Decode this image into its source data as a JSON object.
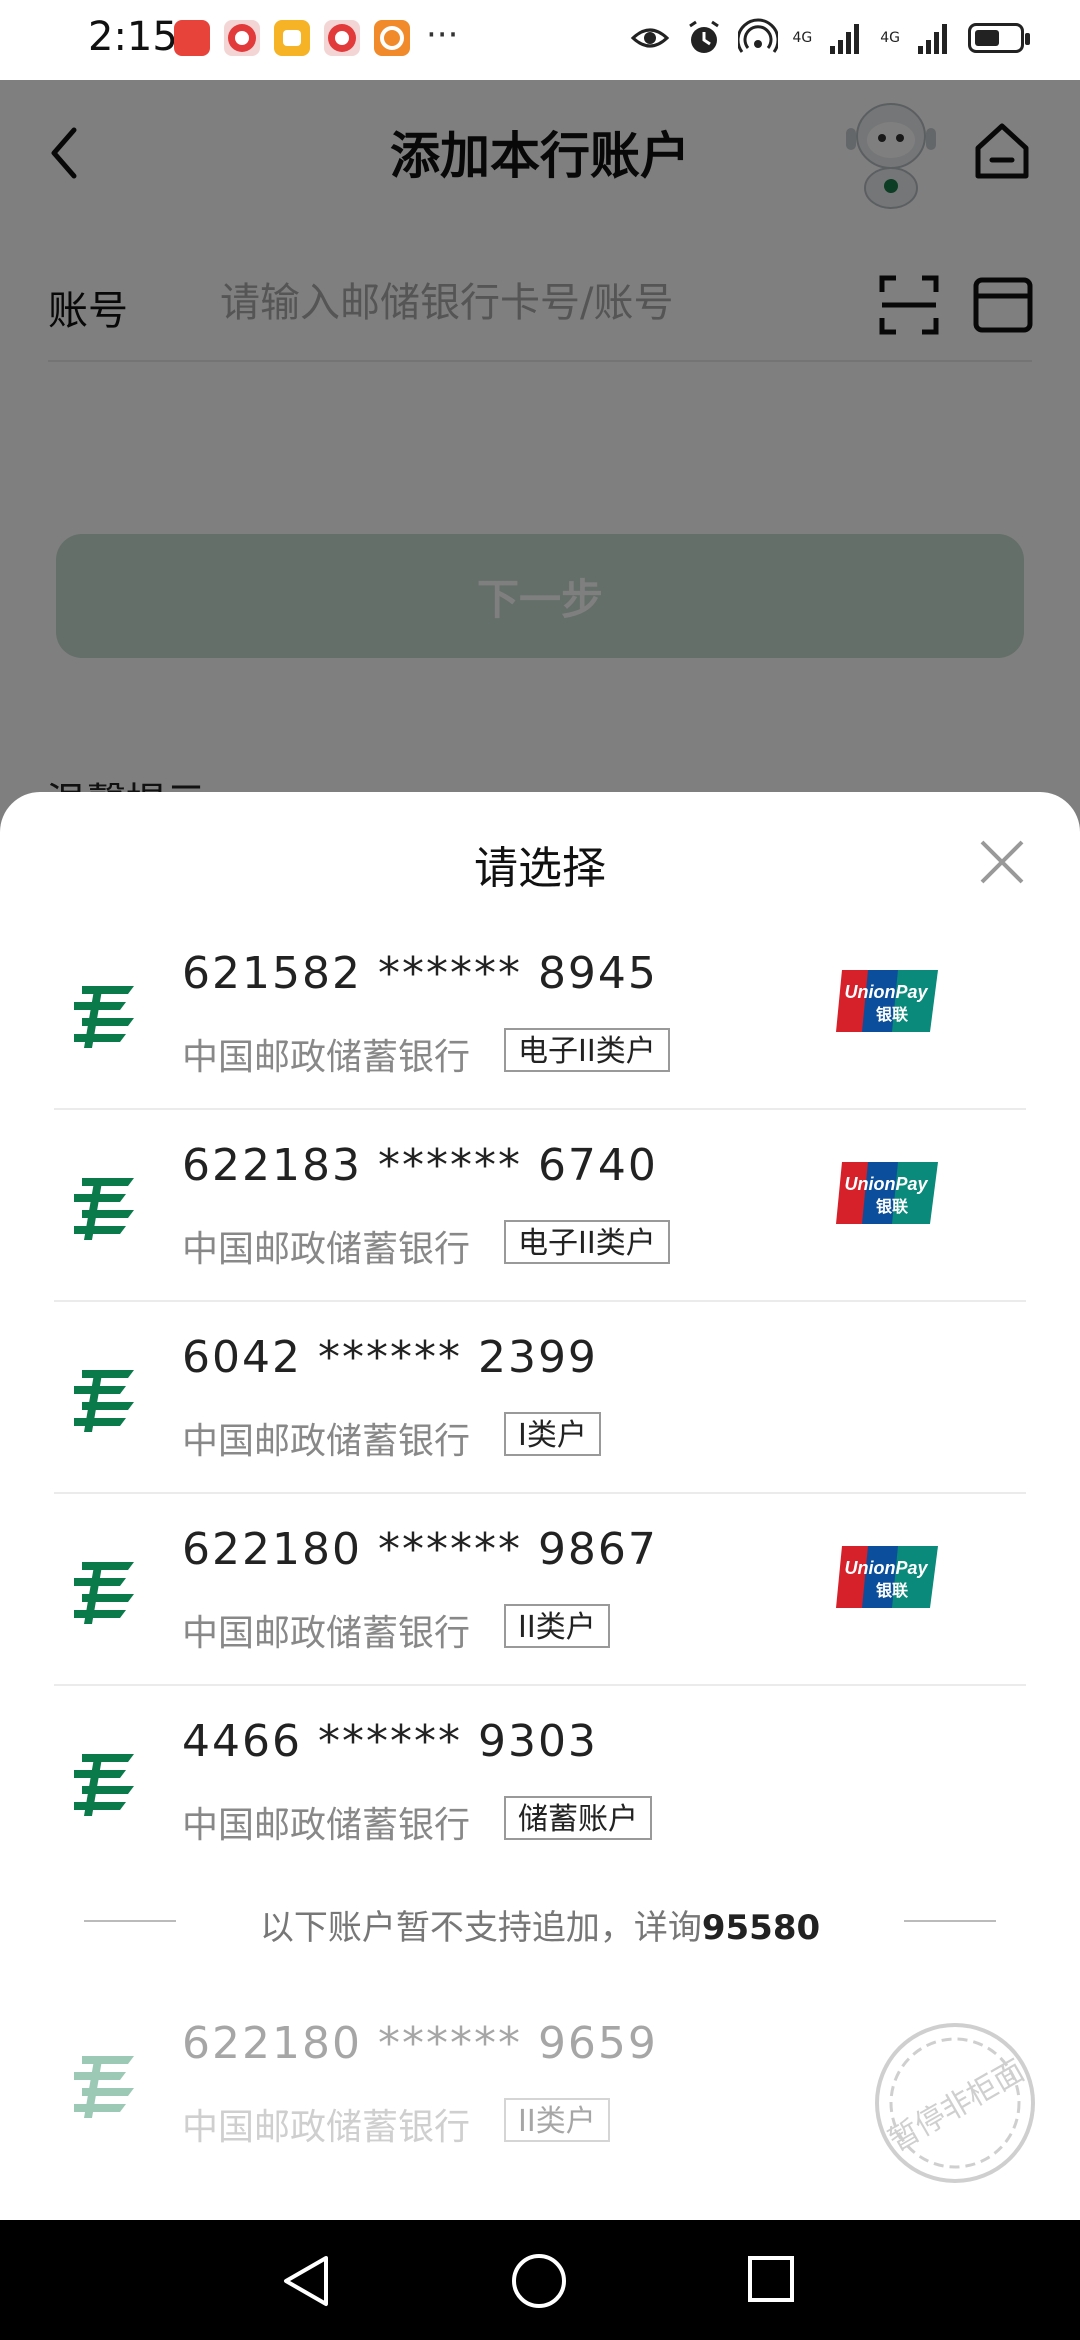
{
  "status_bar": {
    "time": "2:15",
    "more": "···",
    "net_1": "4G",
    "net_2": "4G"
  },
  "header": {
    "title": "添加本行账户"
  },
  "form": {
    "account_label": "账号",
    "account_placeholder": "请输入邮储银行卡号/账号",
    "next_label": "下一步",
    "tips_label": "温馨提示"
  },
  "sheet": {
    "title": "请选择",
    "accounts": [
      {
        "number": "621582 ****** 8945",
        "bank": "中国邮政储蓄银行",
        "tag": "电子II类户",
        "unionpay": true
      },
      {
        "number": "622183 ****** 6740",
        "bank": "中国邮政储蓄银行",
        "tag": "电子II类户",
        "unionpay": true
      },
      {
        "number": "6042 ****** 2399",
        "bank": "中国邮政储蓄银行",
        "tag": "I类户",
        "unionpay": false
      },
      {
        "number": "622180 ****** 9867",
        "bank": "中国邮政储蓄银行",
        "tag": "II类户",
        "unionpay": true
      },
      {
        "number": "4466 ****** 9303",
        "bank": "中国邮政储蓄银行",
        "tag": "储蓄账户",
        "unionpay": false
      }
    ],
    "divider_text": "以下账户暂不支持追加，详询",
    "divider_phone": "95580",
    "disabled_account": {
      "number": "622180 ****** 9659",
      "bank": "中国邮政储蓄银行",
      "tag": "II类户"
    },
    "stamp_text": "暂停非柜面"
  },
  "colors": {
    "brand_green": "#0a7a4a",
    "button_disabled": "#c9ded2"
  }
}
